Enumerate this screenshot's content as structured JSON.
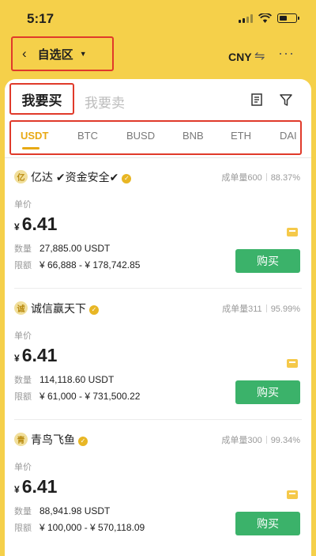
{
  "status": {
    "time": "5:17"
  },
  "nav": {
    "title": "自选区",
    "currency": "CNY",
    "back_icon": "chevron-left-icon",
    "swap_icon": "swap-icon",
    "more_icon": "more-icon"
  },
  "tabs": {
    "buy": "我要买",
    "sell": "我要卖"
  },
  "coins": [
    "USDT",
    "BTC",
    "BUSD",
    "BNB",
    "ETH",
    "DAI"
  ],
  "active_coin": "USDT",
  "labels": {
    "price": "单价",
    "quantity": "数量",
    "limit": "限额",
    "orders": "成单量",
    "buy_button": "购买",
    "yen": "¥"
  },
  "colors": {
    "header": "#f5d04a",
    "accent": "#e8a914",
    "buy": "#3bb26a",
    "highlight": "#e03a2a"
  },
  "offers": [
    {
      "seller": "亿达 ✔资金安全✔",
      "avatar": "亿",
      "orders": "600",
      "completion": "88.37%",
      "price": "6.41",
      "quantity": "27,885.00 USDT",
      "limit": "¥ 66,888 - ¥ 178,742.85"
    },
    {
      "seller": "诚信赢天下",
      "avatar": "诚",
      "orders": "311",
      "completion": "95.99%",
      "price": "6.41",
      "quantity": "114,118.60 USDT",
      "limit": "¥ 61,000 - ¥ 731,500.22"
    },
    {
      "seller": "青鸟飞鱼",
      "avatar": "青",
      "orders": "300",
      "completion": "99.34%",
      "price": "6.41",
      "quantity": "88,941.98 USDT",
      "limit": "¥ 100,000 - ¥ 570,118.09"
    }
  ]
}
